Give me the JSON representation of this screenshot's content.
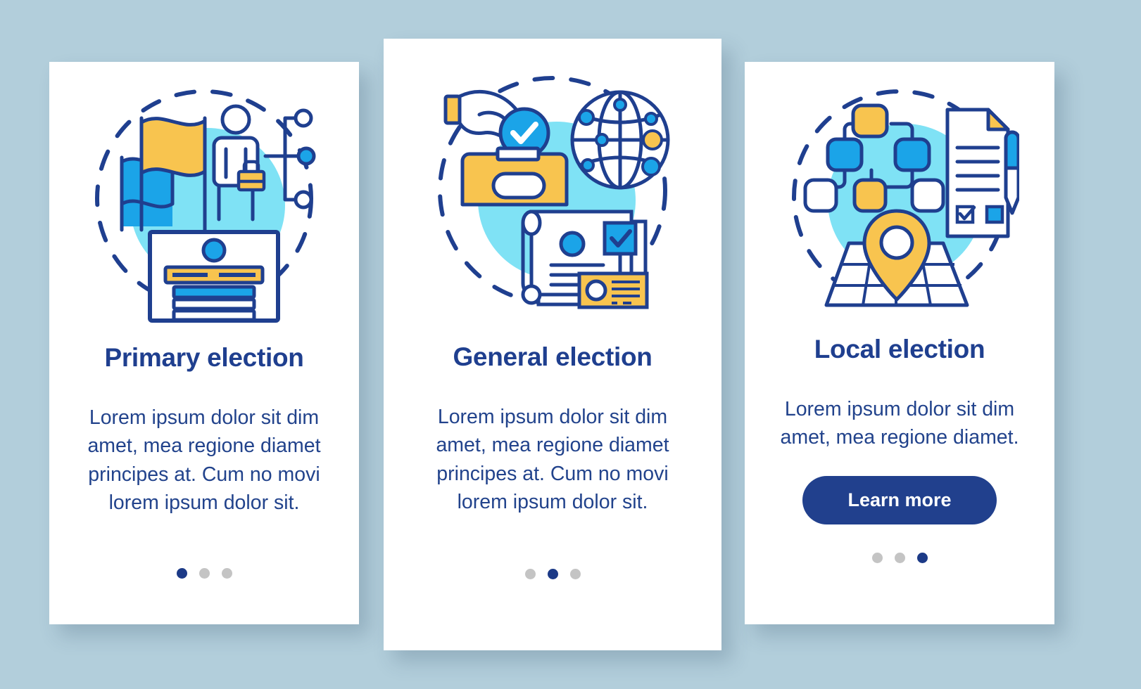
{
  "background_color": "#b2cedb",
  "theme": {
    "navy": "#1f3f8f",
    "blue": "#1ba4e8",
    "light_blue": "#7fe2f5",
    "yellow": "#f8c44f",
    "white": "#ffffff",
    "dot_inactive": "#c4c4c4",
    "dot_active": "#1c3a87",
    "button_bg": "#21408d",
    "button_text": "#ffffff"
  },
  "screens": [
    {
      "id": "primary-election",
      "title": "Primary election",
      "body": "Lorem ipsum dolor sit dim amet, mea regione diamet principes at. Cum no movi lorem ipsum dolor sit.",
      "illustration": "flag-candidate-ballot-illustration",
      "has_cta": false,
      "cta_label": "",
      "dots": {
        "count": 3,
        "active_index": 0
      }
    },
    {
      "id": "general-election",
      "title": "General election",
      "body": "Lorem ipsum dolor sit dim amet, mea regione diamet principes at. Cum no movi lorem ipsum dolor sit.",
      "illustration": "hand-ballot-globe-documents-illustration",
      "has_cta": false,
      "cta_label": "",
      "dots": {
        "count": 3,
        "active_index": 1
      }
    },
    {
      "id": "local-election",
      "title": "Local election",
      "body": "Lorem ipsum dolor sit dim amet, mea regione diamet.",
      "illustration": "org-chart-map-pin-document-illustration",
      "has_cta": true,
      "cta_label": "Learn more",
      "dots": {
        "count": 3,
        "active_index": 2
      }
    }
  ]
}
